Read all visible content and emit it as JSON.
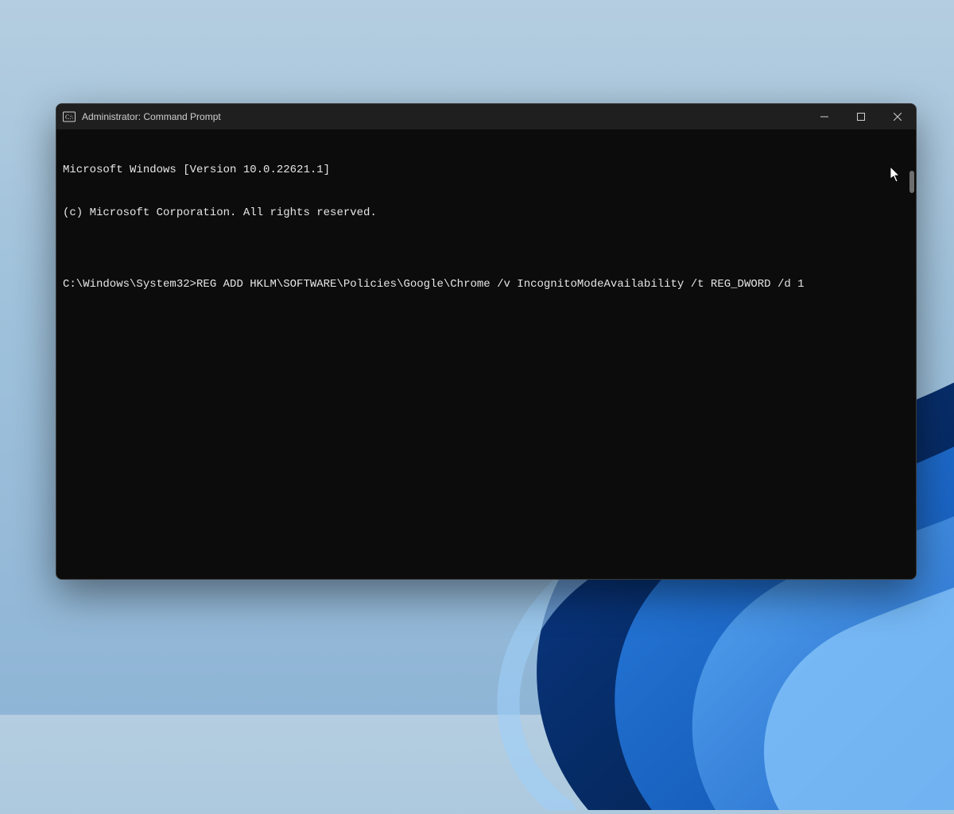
{
  "window": {
    "title": "Administrator: Command Prompt"
  },
  "terminal": {
    "line1": "Microsoft Windows [Version 10.0.22621.1]",
    "line2": "(c) Microsoft Corporation. All rights reserved.",
    "blank": "",
    "prompt": "C:\\Windows\\System32>",
    "command": "REG ADD HKLM\\SOFTWARE\\Policies\\Google\\Chrome /v IncognitoModeAvailability /t REG_DWORD /d 1"
  }
}
